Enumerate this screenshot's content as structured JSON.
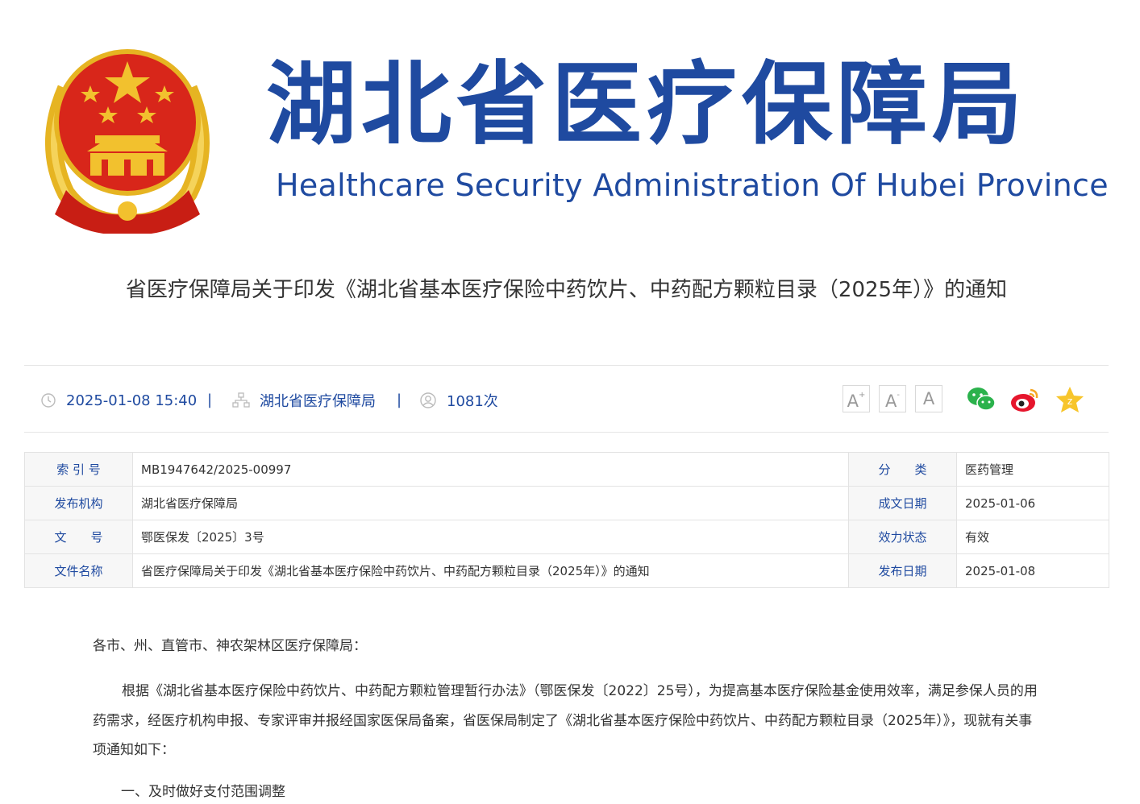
{
  "header": {
    "name_cn": "湖北省医疗保障局",
    "name_en": "Healthcare Security Administration Of Hubei Province"
  },
  "article": {
    "title": "省医疗保障局关于印发《湖北省基本医疗保险中药饮片、中药配方颗粒目录（2025年）》的通知"
  },
  "meta": {
    "datetime": "2025-01-08 15:40",
    "source": "湖北省医疗保障局",
    "views": "1081次",
    "separator": "|"
  },
  "font_size_controls": {
    "large": "A",
    "large_mark": "+",
    "medium": "A",
    "medium_mark": "-",
    "small": "A"
  },
  "share": [
    "wechat-icon",
    "weibo-icon",
    "favorite-icon"
  ],
  "colors": {
    "brand": "#1f4aa0",
    "emblem_red": "#d8261a",
    "emblem_gold": "#f2c12e"
  },
  "info_table": {
    "rows": [
      {
        "l1": "索 引 号",
        "v1": "MB1947642/2025-00997",
        "l2": "分　　类",
        "v2": "医药管理"
      },
      {
        "l1": "发布机构",
        "v1": "湖北省医疗保障局",
        "l2": "成文日期",
        "v2": "2025-01-06"
      },
      {
        "l1": "文　　号",
        "v1": "鄂医保发〔2025〕3号",
        "l2": "效力状态",
        "v2": "有效"
      },
      {
        "l1": "文件名称",
        "v1": "省医疗保障局关于印发《湖北省基本医疗保险中药饮片、中药配方颗粒目录（2025年）》的通知",
        "l2": "发布日期",
        "v2": "2025-01-08"
      }
    ]
  },
  "content": {
    "salutation": "各市、州、直管市、神农架林区医疗保障局：",
    "paragraph1": "根据《湖北省基本医疗保险中药饮片、中药配方颗粒管理暂行办法》（鄂医保发〔2022〕25号），为提高基本医疗保险基金使用效率，满足参保人员的用药需求，经医疗机构申报、专家评审并报经国家医保局备案，省医保局制定了《湖北省基本医疗保险中药饮片、中药配方颗粒目录（2025年）》，现就有关事项通知如下：",
    "section1": "一、及时做好支付范围调整"
  }
}
